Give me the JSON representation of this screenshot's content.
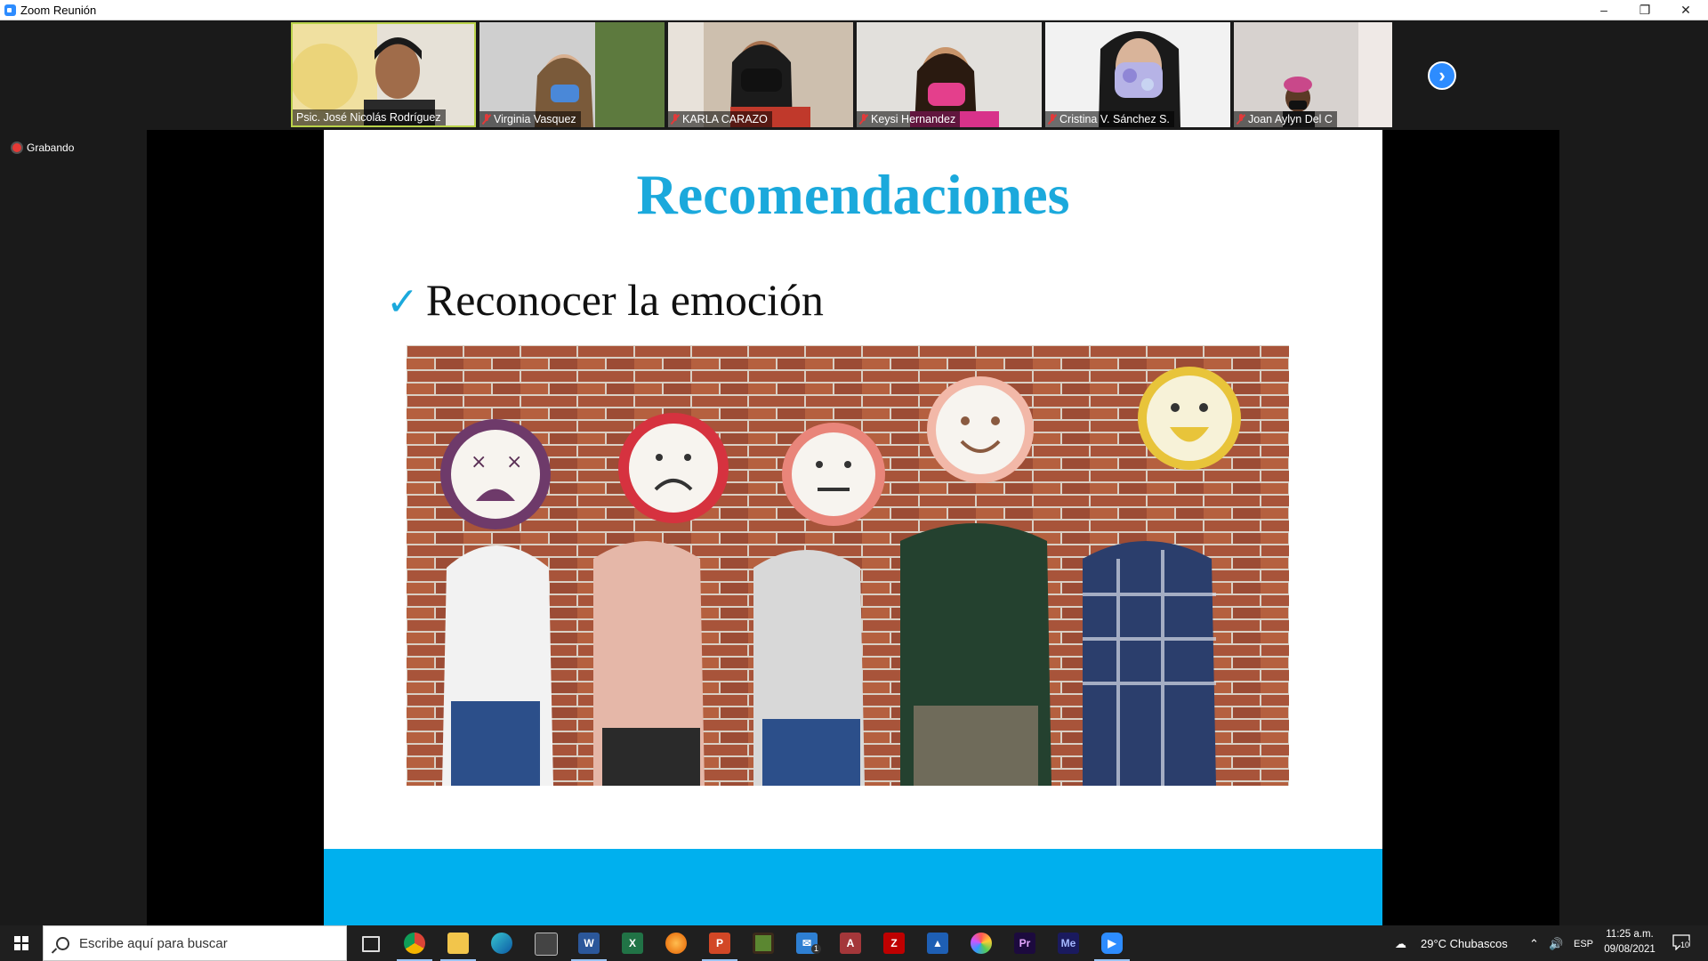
{
  "window": {
    "title": "Zoom Reunión"
  },
  "participants": [
    {
      "name": "Psic. José Nicolás Rodríguez",
      "muted": false,
      "active": true
    },
    {
      "name": "Virginia Vasquez",
      "muted": true,
      "active": false
    },
    {
      "name": "KARLA CARAZO",
      "muted": true,
      "active": false
    },
    {
      "name": "Keysi Hernandez",
      "muted": true,
      "active": false
    },
    {
      "name": "Cristina V. Sánchez S.",
      "muted": true,
      "active": false
    },
    {
      "name": "Joan Aylyn Del C",
      "muted": true,
      "active": false
    }
  ],
  "recording": {
    "label": "Grabando"
  },
  "slide": {
    "title": "Recomendaciones",
    "bullet": "Reconocer la emoción",
    "check_glyph": "✓",
    "accent_color": "#1ba9dc",
    "band_color": "#00b0ee"
  },
  "taskbar": {
    "search_placeholder": "Escribe aquí para buscar",
    "apps": [
      "task-view",
      "chrome",
      "file-explorer",
      "edge",
      "store",
      "word",
      "excel",
      "firefox",
      "powerpoint",
      "minecraft",
      "mail",
      "access",
      "filezilla",
      "photo-editor",
      "paint",
      "premiere",
      "media-encoder",
      "zoom"
    ],
    "mail_badge": "1",
    "weather": "29°C  Chubascos",
    "language": "ESP",
    "time": "11:25 a.m.",
    "date": "09/08/2021",
    "notifications": "10"
  }
}
